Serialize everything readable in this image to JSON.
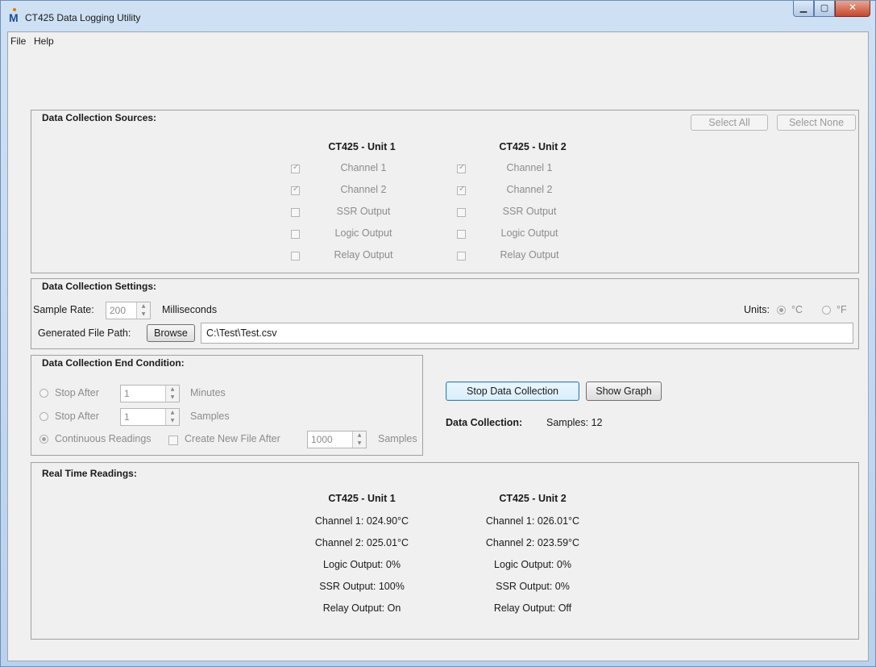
{
  "window": {
    "title": "CT425 Data Logging Utility",
    "icon_letter": "M"
  },
  "menu": {
    "items": [
      "File",
      "Help"
    ]
  },
  "sources": {
    "title": "Data Collection Sources:",
    "select_all": "Select All",
    "select_none": "Select None",
    "unit1_header": "CT425 - Unit 1",
    "unit2_header": "CT425 - Unit 2",
    "channels": [
      "Channel 1",
      "Channel 2",
      "SSR Output",
      "Logic Output",
      "Relay Output"
    ],
    "unit1_checked": [
      true,
      true,
      false,
      false,
      false
    ],
    "unit2_checked": [
      true,
      true,
      false,
      false,
      false
    ]
  },
  "settings": {
    "title": "Data Collection Settings:",
    "sample_rate_label": "Sample Rate:",
    "sample_rate_value": "200",
    "sample_rate_unit": "Milliseconds",
    "units_label": "Units:",
    "unit_c": "°C",
    "unit_f": "°F",
    "file_path_label": "Generated File Path:",
    "browse_label": "Browse",
    "file_path_value": "C:\\Test\\Test.csv"
  },
  "end_condition": {
    "title": "Data Collection End Condition:",
    "stop_after_label": "Stop After",
    "minutes_value": "1",
    "minutes_unit": "Minutes",
    "samples_value": "1",
    "samples_unit": "Samples",
    "continuous_label": "Continuous Readings",
    "create_new_file_label": "Create New File After",
    "new_file_value": "1000",
    "new_file_unit": "Samples"
  },
  "actions": {
    "stop_label": "Stop Data Collection",
    "graph_label": "Show Graph",
    "status_label": "Data Collection:",
    "status_value": "Samples: 12"
  },
  "readings": {
    "title": "Real Time Readings:",
    "unit1_header": "CT425 - Unit 1",
    "unit2_header": "CT425 - Unit 2",
    "unit1": [
      "Channel 1: 024.90°C",
      "Channel 2: 025.01°C",
      "Logic Output: 0%",
      "SSR Output: 100%",
      "Relay Output: On"
    ],
    "unit2": [
      "Channel 1: 026.01°C",
      "Channel 2: 023.59°C",
      "Logic Output: 0%",
      "SSR Output: 0%",
      "Relay Output: Off"
    ]
  }
}
